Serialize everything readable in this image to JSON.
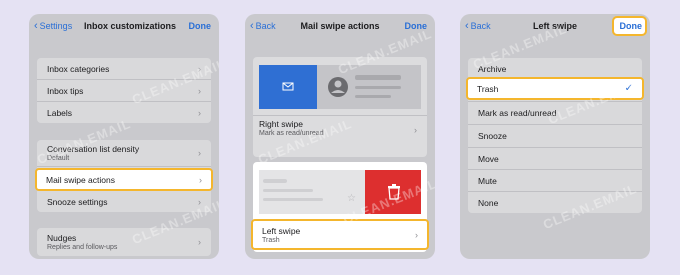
{
  "panel1": {
    "back_label": "Settings",
    "title": "Inbox customizations",
    "done_label": "Done",
    "group1": [
      "Inbox categories",
      "Inbox tips",
      "Labels"
    ],
    "group2": {
      "density_label": "Conversation list density",
      "density_value": "Default",
      "mail_swipe_label": "Mail swipe actions",
      "snooze_label": "Snooze settings"
    },
    "nudges_label": "Nudges",
    "nudges_sub": "Replies and follow-ups"
  },
  "panel2": {
    "back_label": "Back",
    "title": "Mail swipe actions",
    "done_label": "Done",
    "right_swipe_label": "Right swipe",
    "right_swipe_value": "Mark as read/unread",
    "left_swipe_label": "Left swipe",
    "left_swipe_value": "Trash"
  },
  "panel3": {
    "back_label": "Back",
    "title": "Left swipe",
    "done_label": "Done",
    "options": [
      "Archive",
      "Trash",
      "Mark as read/unread",
      "Snooze",
      "Move",
      "Mute",
      "None"
    ],
    "selected": "Trash"
  },
  "watermark": "CLEAN.EMAIL",
  "colors": {
    "accent": "#2a6fd6",
    "highlight": "#f4b62d",
    "right_swipe_blue": "#2f6fd3",
    "left_swipe_red": "#dd2f2f",
    "background": "#e5e2f3"
  }
}
